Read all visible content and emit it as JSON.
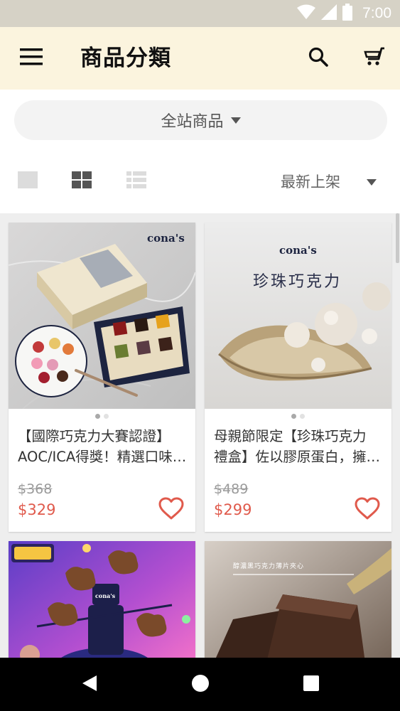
{
  "status_bar": {
    "time": "7:00"
  },
  "app_bar": {
    "title": "商品分類"
  },
  "filter": {
    "label": "全站商品"
  },
  "sort": {
    "label": "最新上架"
  },
  "products": [
    {
      "title_line1": "【國際巧克力大賽認證】",
      "title_line2": "AOC/ICA得獎！精選口味…",
      "original_price": "$368",
      "price": "$329",
      "image_brand": "cona's"
    },
    {
      "title_line1": "母親節限定【珍珠巧克力",
      "title_line2": "禮盒】佐以膠原蛋白，擁…",
      "original_price": "$489",
      "price": "$299",
      "image_brand": "cona's",
      "image_caption": "珍珠巧克力"
    },
    {
      "image_brand": "cona's"
    },
    {
      "image_caption": "醇濃黑巧克力薄片夾心"
    }
  ],
  "colors": {
    "accent": "#e05a4c",
    "app_bar": "#fbf4de"
  }
}
